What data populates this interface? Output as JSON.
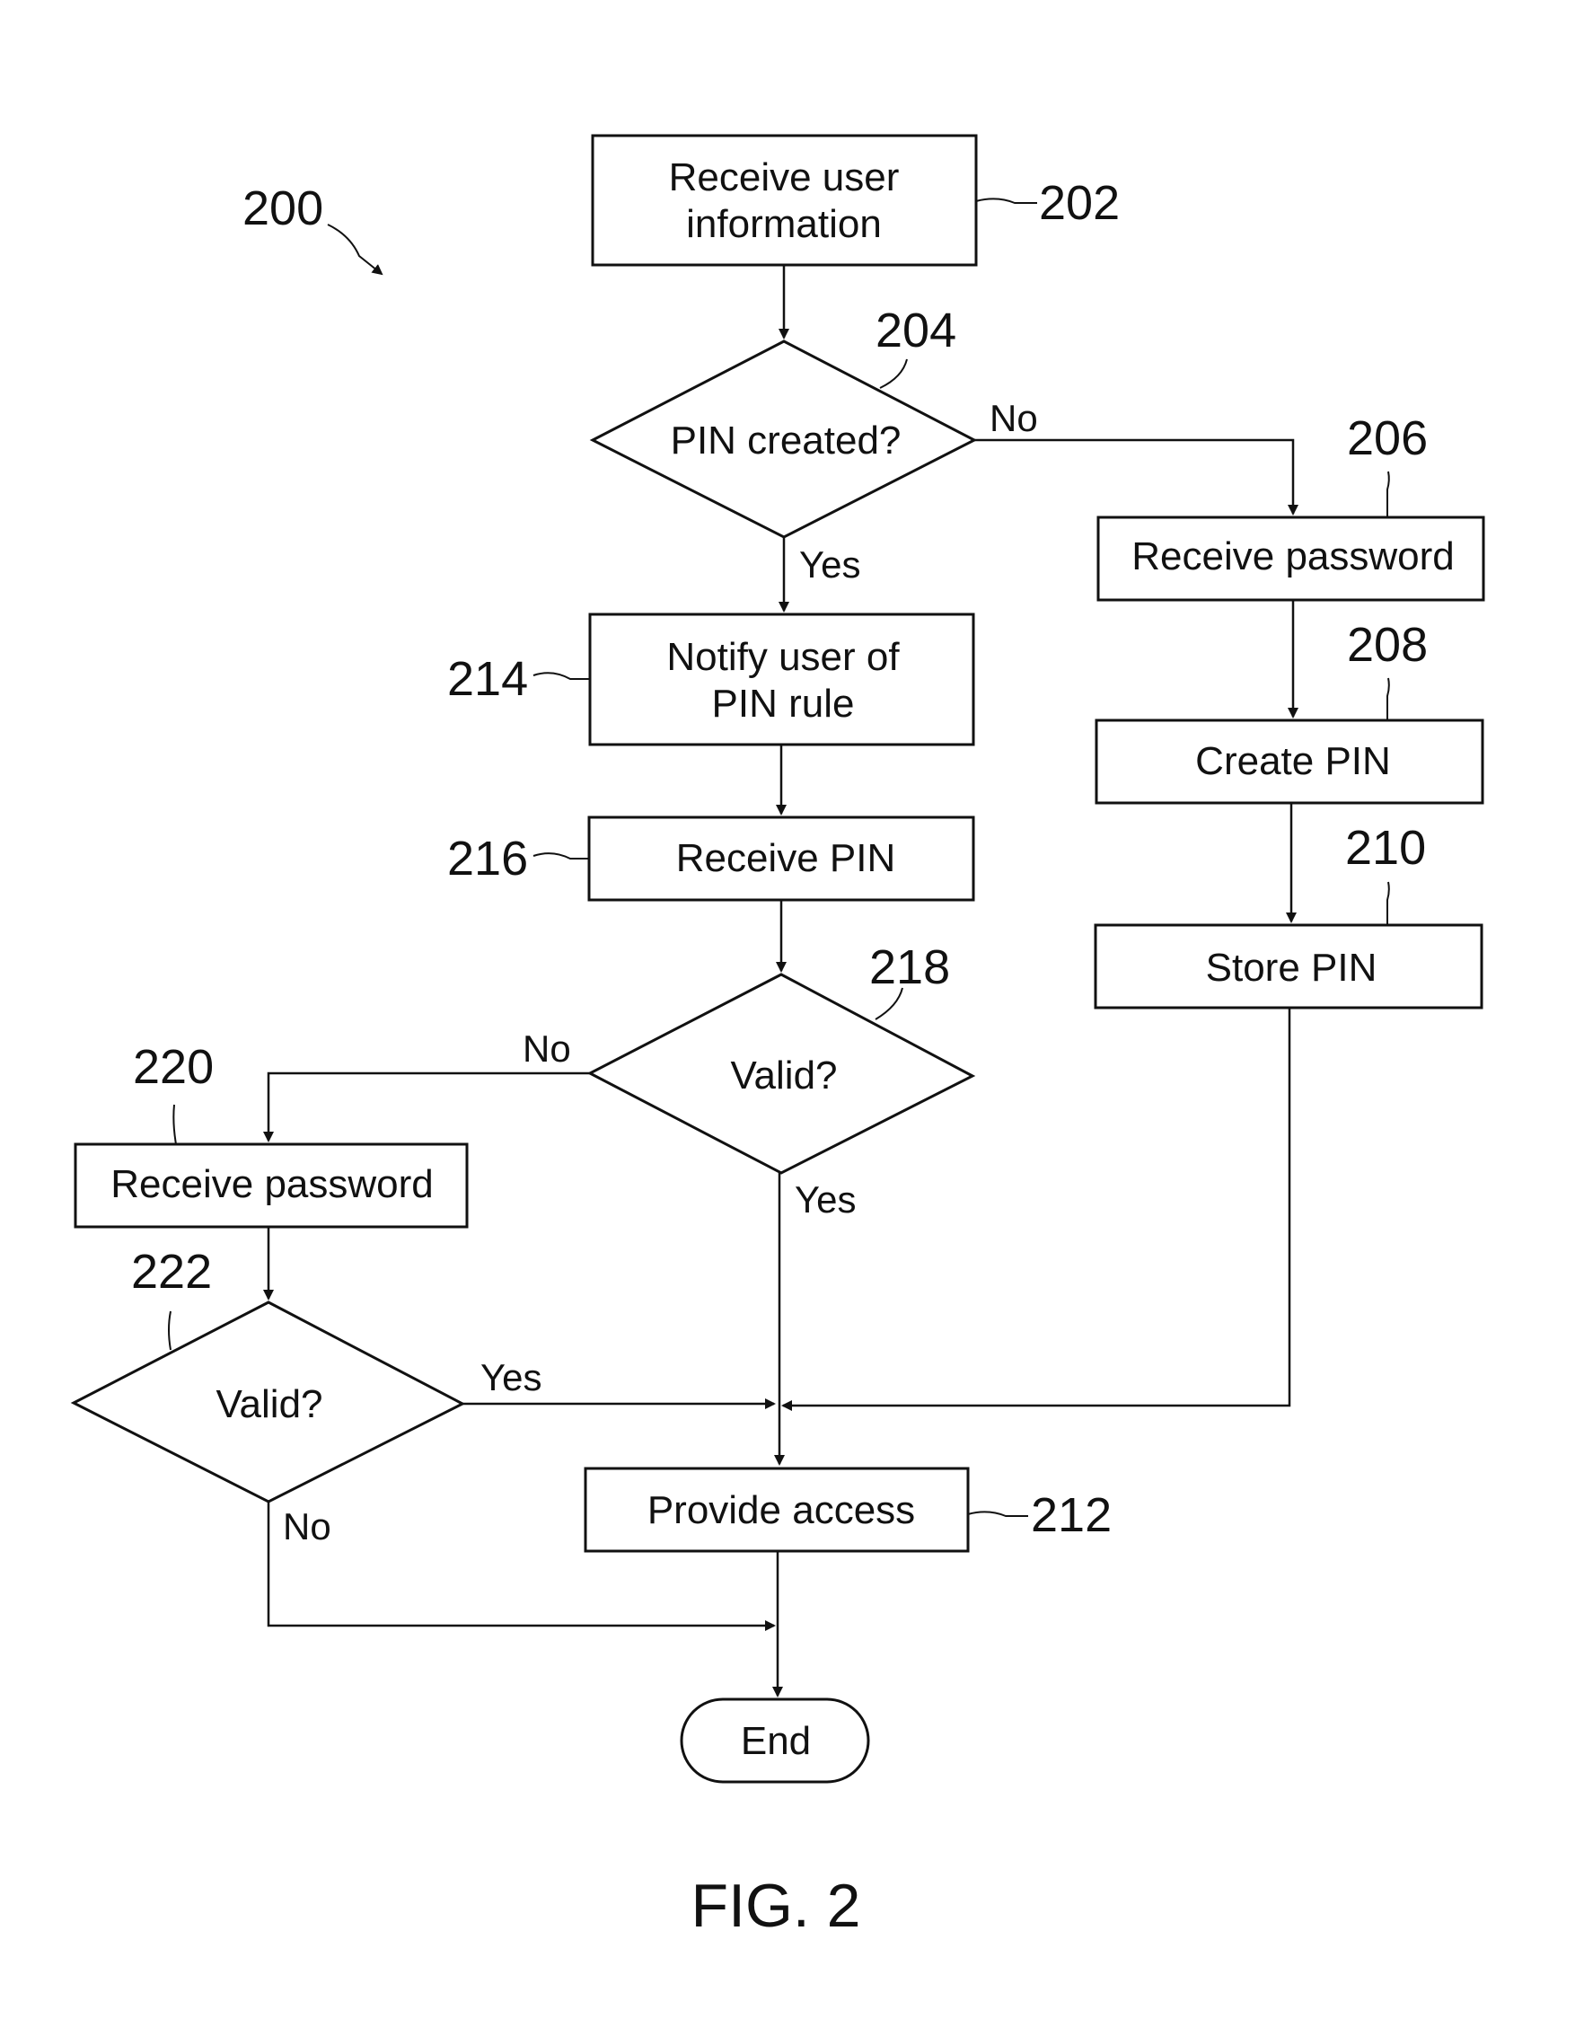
{
  "figure": {
    "caption": "FIG. 2",
    "ref": "200"
  },
  "nodes": {
    "n202": {
      "ref": "202",
      "lines": [
        "Receive user",
        "information"
      ]
    },
    "n204": {
      "ref": "204",
      "lines": [
        "PIN created?"
      ]
    },
    "n206": {
      "ref": "206",
      "lines": [
        "Receive password"
      ]
    },
    "n208": {
      "ref": "208",
      "lines": [
        "Create PIN"
      ]
    },
    "n210": {
      "ref": "210",
      "lines": [
        "Store PIN"
      ]
    },
    "n212": {
      "ref": "212",
      "lines": [
        "Provide access"
      ]
    },
    "n214": {
      "ref": "214",
      "lines": [
        "Notify user of",
        "PIN rule"
      ]
    },
    "n216": {
      "ref": "216",
      "lines": [
        "Receive PIN"
      ]
    },
    "n218": {
      "ref": "218",
      "lines": [
        "Valid?"
      ]
    },
    "n220": {
      "ref": "220",
      "lines": [
        "Receive password"
      ]
    },
    "n222": {
      "ref": "222",
      "lines": [
        "Valid?"
      ]
    },
    "end": {
      "lines": [
        "End"
      ]
    }
  },
  "edge_labels": {
    "e204_no": "No",
    "e204_yes": "Yes",
    "e218_no": "No",
    "e218_yes": "Yes",
    "e222_yes": "Yes",
    "e222_no": "No"
  }
}
